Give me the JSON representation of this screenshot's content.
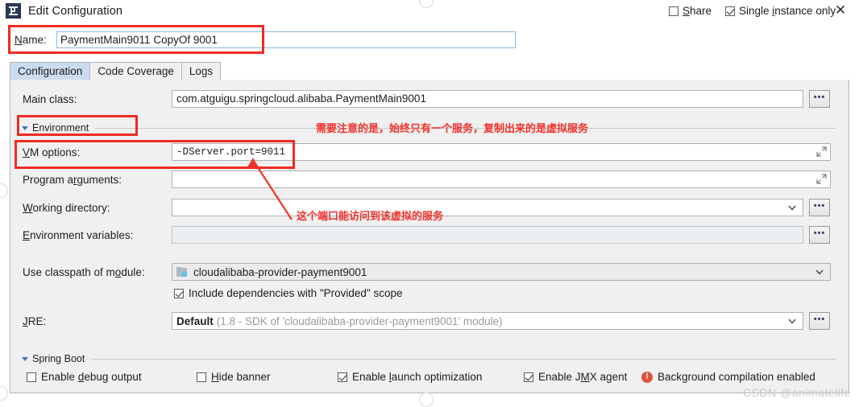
{
  "window": {
    "title": "Edit Configuration",
    "app_icon": "intellij-idea-icon",
    "close_label": "✕"
  },
  "name_row": {
    "label": "Name:",
    "label_mnemonic": "N",
    "value": "PaymentMain9011 CopyOf 9001",
    "placeholder": "",
    "share": {
      "label": "Share",
      "mnemonic": "S",
      "checked": false
    },
    "single_instance": {
      "label": "Single instance only",
      "mnemonic": "i",
      "checked": true
    }
  },
  "tabs": [
    {
      "label": "Configuration",
      "active": true
    },
    {
      "label": "Code Coverage",
      "active": false
    },
    {
      "label": "Logs",
      "active": false
    }
  ],
  "form": {
    "main_class": {
      "label": "Main class:",
      "value": "com.atguigu.springcloud.alibaba.PaymentMain9001",
      "browse_label": "•••"
    },
    "environment_section": {
      "label": "Environment",
      "expanded": true
    },
    "vm_options": {
      "label": "VM options:",
      "label_mnemonic": "V",
      "value": "-DServer.port=9011",
      "expand_icon": "expand-diagonal-icon"
    },
    "program_arguments": {
      "label": "Program arguments:",
      "label_mnemonic": "r",
      "value": "",
      "expand_icon": "expand-diagonal-icon"
    },
    "working_directory": {
      "label": "Working directory:",
      "label_mnemonic": "W",
      "value": "",
      "dropdown_icon": "chevron-down-icon",
      "browse_label": "•••"
    },
    "environment_variables": {
      "label": "Environment variables:",
      "label_mnemonic": "E",
      "value": "",
      "disabled": true,
      "browse_label": "•••"
    },
    "classpath_module": {
      "label": "Use classpath of module:",
      "label_mnemonic": "o",
      "value": "cloudalibaba-provider-payment9001",
      "module_icon": "module-folder-icon",
      "dropdown_icon": "chevron-down-icon"
    },
    "include_dependencies": {
      "label": "Include dependencies with \"Provided\" scope",
      "checked": true
    },
    "jre": {
      "label": "JRE:",
      "label_mnemonic": "J",
      "value_primary": "Default",
      "value_secondary": "(1.8 - SDK of 'cloudalibaba-provider-payment9001' module)",
      "dropdown_icon": "chevron-down-icon",
      "browse_label": "•••"
    },
    "spring_boot_section": {
      "label": "Spring Boot",
      "expanded": true
    },
    "spring_boot_options": [
      {
        "label": "Enable debug output",
        "mnemonic": "d",
        "checked": false
      },
      {
        "label": "Hide banner",
        "mnemonic": "H",
        "checked": false
      },
      {
        "label": "Enable launch optimization",
        "mnemonic": "l",
        "checked": true
      },
      {
        "label": "Enable JMX agent",
        "mnemonic": "M",
        "checked": true
      }
    ],
    "background_compilation": {
      "icon": "warning-icon",
      "label": "Background compilation enabled"
    }
  },
  "annotations": {
    "note_top": "需要注意的是，始终只有一个服务，复制出来的是虚拟服务",
    "note_arrow": "这个端口能访问到该虚拟的服务",
    "box_color": "#ef2b23",
    "text_color": "#f0322a"
  },
  "watermark": "CSDN @animatelife"
}
